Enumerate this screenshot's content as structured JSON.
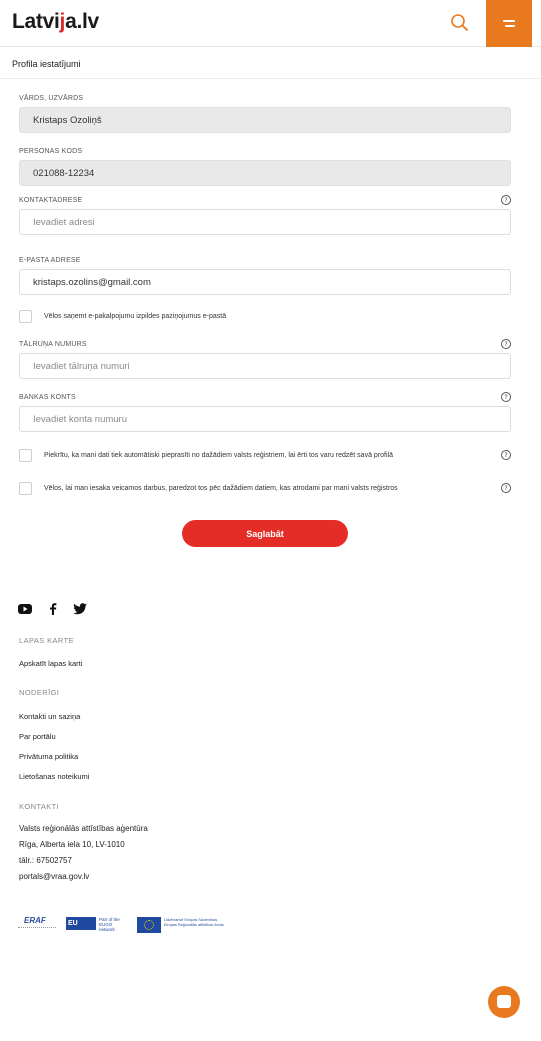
{
  "header": {
    "logo_text_1": "Latvi",
    "logo_mark": "j",
    "logo_text_2": "a.lv",
    "search_icon": "search-icon",
    "menu_icon": "menu-icon"
  },
  "breadcrumb": "Profila iestatījumi",
  "form": {
    "name_label": "Vārds, uzvārds",
    "name_value": "Kristaps Ozoliņš",
    "code_label": "Personas kods",
    "code_value": "021088-12234",
    "address_label": "Kontaktadrese",
    "address_placeholder": "Ievadiet adresi",
    "email_label": "E-pasta adrese",
    "email_value": "kristaps.ozolins@gmail.com",
    "email_notify_label": "Vēlos saņemt e-pakalpojumu izpildes paziņojumus e-pastā",
    "phone_label": "Tālruņa numurs",
    "phone_placeholder": "Ievadiet tālruņa numuri",
    "bank_label": "Bankas konts",
    "bank_placeholder": "Ievadiet konta numuru",
    "consent_label": "Piekrītu, ka mani dati tiek automātiski pieprasīti no dažādiem valsts reģistriem, lai ērti tos varu redzēt savā profilā",
    "suggest_label": "Vēlos, lai man iesaka veicamos darbus, paredzot tos pēc dažādiem datiem, kas atrodami par mani valsts reģistros",
    "help_symbol": "?",
    "save_label": "Saglabāt"
  },
  "footer": {
    "social_icons": [
      "youtube-icon",
      "facebook-icon",
      "twitter-icon"
    ],
    "sitemap_heading": "Lapas karte",
    "sitemap_link": "Apskatīt lapas karti",
    "useful_heading": "Noderīgi",
    "useful_links": [
      "Kontakti un saziņa",
      "Par portālu",
      "Privātuma politika",
      "Lietošanas noteikumi"
    ],
    "contacts_heading": "Kontakti",
    "contacts_lines": [
      "Valsts reģionālās attīstības aģentūra",
      "Rīga, Alberta iela 10, LV-1010",
      "tālr.: 67502757",
      "portals@vraa.gov.lv"
    ],
    "eraf_label": "ERAF",
    "euco_label": "EU",
    "euco_sub": "Part of the EUGO network",
    "eu_sub": "Līdzfinansē Eiropas Savienības Eiropas Reģionālās attīstības fonds"
  },
  "colors": {
    "accent": "#e8791e",
    "primary_button": "#e52d27"
  },
  "chat_icon": "chat-icon"
}
